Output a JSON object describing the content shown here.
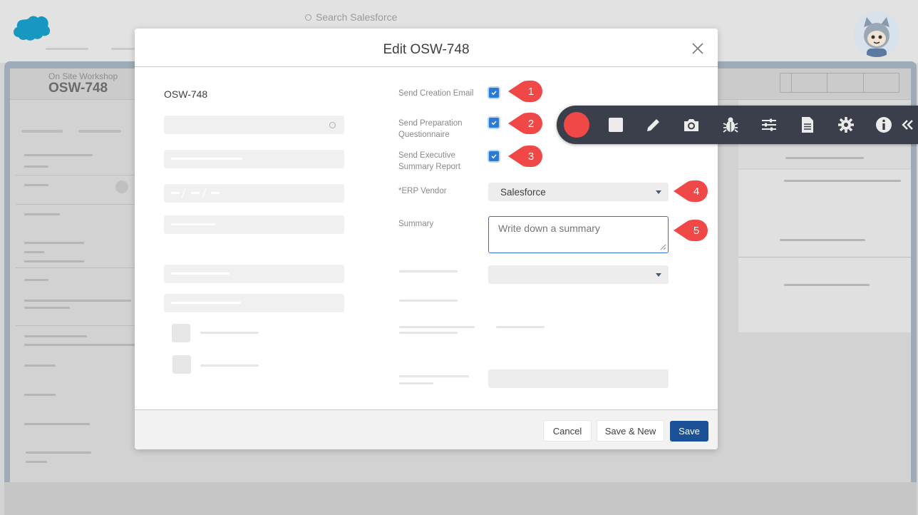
{
  "app": {
    "search_placeholder": "Search Salesforce",
    "record_type": "On Site Workshop",
    "record_name": "OSW-748"
  },
  "modal": {
    "title": "Edit OSW-748",
    "record_name": "OSW-748",
    "fields": {
      "send_creation_email": {
        "label": "Send Creation Email",
        "checked": true
      },
      "send_preparation_questionnaire": {
        "label_line1": "Send Preparation",
        "label_line2": "Questionnaire",
        "checked": true
      },
      "send_executive_summary": {
        "label_line1": "Send Executive",
        "label_line2": "Summary Report",
        "checked": true
      },
      "erp_vendor": {
        "label": "*ERP Vendor",
        "value": "Salesforce"
      },
      "summary": {
        "label": "Summary",
        "placeholder": "Write down a summary"
      }
    },
    "footer": {
      "cancel": "Cancel",
      "save_new": "Save & New",
      "save": "Save"
    }
  },
  "markers": [
    "1",
    "2",
    "3",
    "4",
    "5"
  ],
  "recorder_toolbar": {
    "tools": [
      "record-button",
      "stop-icon",
      "pencil-icon",
      "camera-icon",
      "bug-icon",
      "sliders-icon",
      "document-icon",
      "gear-icon",
      "info-icon",
      "collapse-chevrons-icon"
    ]
  },
  "colors": {
    "accent": "#2a7ad6",
    "save_button": "#1b5297",
    "marker": "#f04747",
    "toolbar_bg": "#3b3e4b"
  }
}
